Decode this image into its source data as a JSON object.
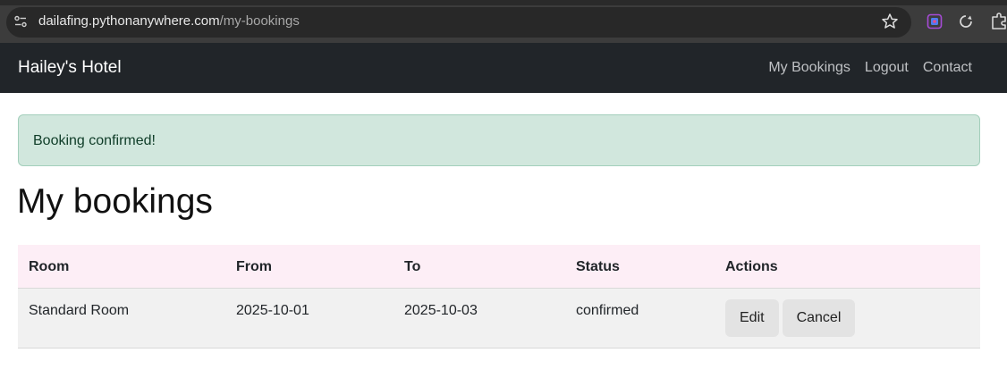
{
  "browser": {
    "url_host": "dailafing.pythonanywhere.com",
    "url_path": "/my-bookings",
    "icons": [
      "site-info-icon",
      "star-icon",
      "extension-icon",
      "sync-icon",
      "puzzle-icon"
    ]
  },
  "navbar": {
    "brand": "Hailey's Hotel",
    "links": [
      "My Bookings",
      "Logout",
      "Contact"
    ],
    "background": "#212529"
  },
  "alert": {
    "message": "Booking confirmed!",
    "background": "#d1e7dd"
  },
  "page": {
    "title": "My bookings"
  },
  "bookings_table": {
    "headers": [
      "Room",
      "From",
      "To",
      "Status",
      "Actions"
    ],
    "header_background": "#fdeef6",
    "rows": [
      {
        "room": "Standard Room",
        "from": "2025-10-01",
        "to": "2025-10-03",
        "status": "confirmed",
        "actions": [
          "Edit",
          "Cancel"
        ]
      }
    ]
  }
}
